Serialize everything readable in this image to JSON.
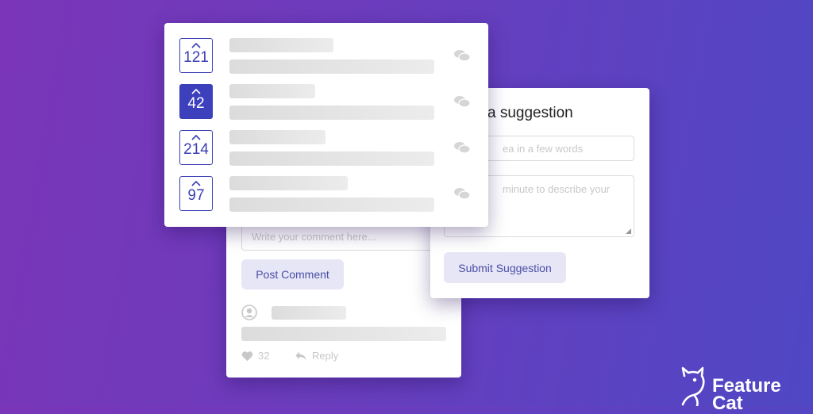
{
  "comment_card": {
    "input_placeholder": "Write your comment here...",
    "post_button": "Post Comment",
    "likes": "32",
    "reply": "Reply"
  },
  "suggestion_card": {
    "title": "a suggestion",
    "title_input_placeholder": "ea in a few words",
    "description_placeholder": "minute to describe your",
    "submit_button": "Submit Suggestion"
  },
  "feature_list": [
    {
      "votes": "121",
      "active": false
    },
    {
      "votes": "42",
      "active": true
    },
    {
      "votes": "214",
      "active": false
    },
    {
      "votes": "97",
      "active": false
    }
  ],
  "logo": {
    "line1": "Feature",
    "line2": "Cat"
  },
  "colors": {
    "accent": "#3d40bd",
    "button_bg": "#e6e6f6",
    "button_text": "#4b4ea6"
  }
}
